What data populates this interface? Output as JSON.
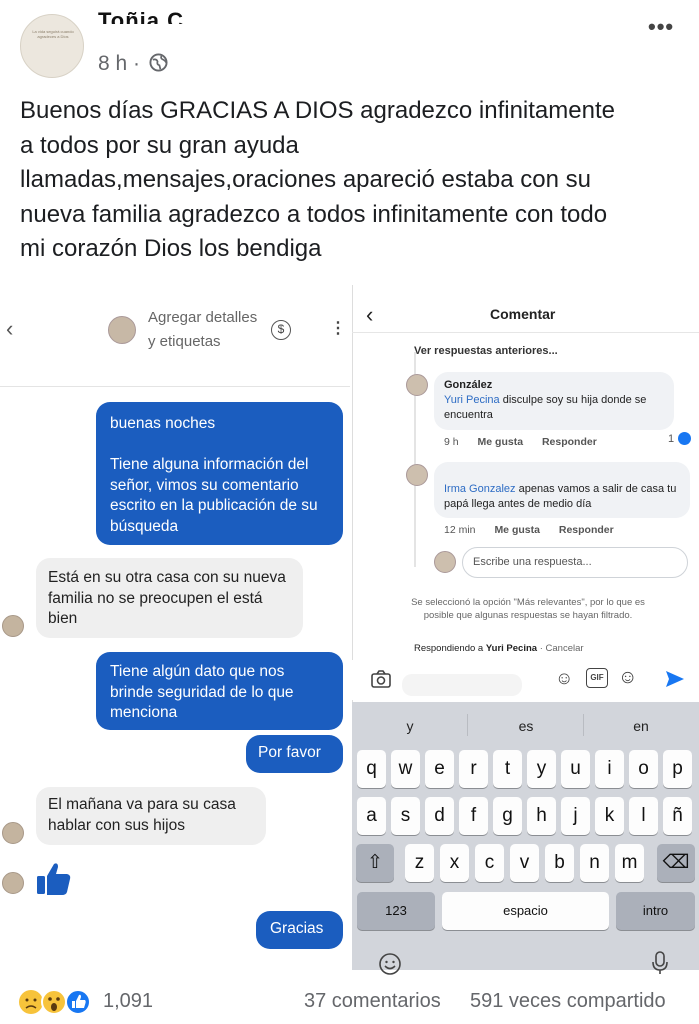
{
  "post": {
    "author": "Toñia C",
    "time": "8 h ·",
    "privacy_icon": "globe-icon",
    "text_lines": [
      "Buenos días GRACIAS A DIOS  agradezco infinitamente",
      "a todos por su gran ayuda",
      "llamadas,mensajes,oraciones apareció estaba con su",
      "nueva familia agradezco a todos infinitamente con todo",
      "mi corazón Dios los bendiga"
    ]
  },
  "left_chat": {
    "header_title": "Agregar detalles y etiquetas",
    "messages": [
      {
        "dir": "out",
        "text": "buenas noches\n\nTiene alguna información del señor, vimos su comentario escrito en la publicación de su búsqueda"
      },
      {
        "dir": "in",
        "text": "Está en su otra casa con su nueva familia no se preocupen el está bien"
      },
      {
        "dir": "out",
        "text": "Tiene algún dato que nos brinde seguridad de lo que menciona"
      },
      {
        "dir": "out",
        "text": "Por favor"
      },
      {
        "dir": "in",
        "text": "El mañana va para su casa hablar con sus hijos"
      },
      {
        "dir": "out",
        "text": "Gracias"
      }
    ]
  },
  "right_comments": {
    "title": "Comentar",
    "view_previous": "Ver respuestas anteriores...",
    "comments": [
      {
        "author": "González",
        "mention": "Yuri Pecina",
        "text": " disculpe soy su hija donde se encuentra",
        "time": "9 h",
        "like": "Me gusta",
        "reply": "Responder",
        "likes": "1"
      },
      {
        "author": "",
        "mention": "Irma Gonzalez",
        "text": " apenas vamos a salir de casa tu papá llega antes de medio día",
        "time": "12 min",
        "like": "Me gusta",
        "reply": "Responder"
      }
    ],
    "reply_placeholder": "Escribe una respuesta...",
    "filter_note": "Se seleccionó la opción \"Más relevantes\", por lo que es posible que algunas respuestas se hayan filtrado.",
    "replying_prefix": "Respondiendo a ",
    "replying_name": "Yuri Pecina",
    "replying_cancel": " · Cancelar"
  },
  "keyboard": {
    "suggestions": [
      "y",
      "es",
      "en"
    ],
    "row1": [
      "q",
      "w",
      "e",
      "r",
      "t",
      "y",
      "u",
      "i",
      "o",
      "p"
    ],
    "row2": [
      "a",
      "s",
      "d",
      "f",
      "g",
      "h",
      "j",
      "k",
      "l",
      "ñ"
    ],
    "row3": [
      "z",
      "x",
      "c",
      "v",
      "b",
      "n",
      "m"
    ],
    "num_label": "123",
    "space_label": "espacio",
    "return_label": "intro"
  },
  "footer": {
    "reaction_count": "1,091",
    "comments": "37 comentarios",
    "shares": "591 veces compartido"
  },
  "colors": {
    "outgoing_bubble": "#1b5dbf",
    "incoming_bubble": "#efefef",
    "mention": "#2d6cc4",
    "keyboard_bg": "#d2d5db"
  }
}
